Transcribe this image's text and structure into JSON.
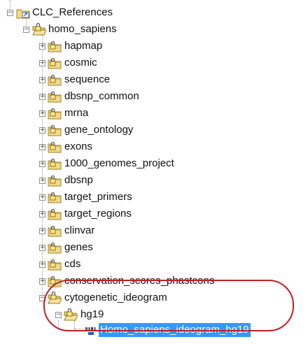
{
  "tree": {
    "root": {
      "label": "CLC_References",
      "icon": "database-folder-icon",
      "expanded": true
    },
    "homo_sapiens": {
      "label": "homo_sapiens",
      "icon": "locked-folder-open-icon",
      "expanded": true
    },
    "children": [
      {
        "label": "hapmap",
        "icon": "locked-folder-icon",
        "expanded": false
      },
      {
        "label": "cosmic",
        "icon": "locked-folder-icon",
        "expanded": false
      },
      {
        "label": "sequence",
        "icon": "locked-folder-icon",
        "expanded": false
      },
      {
        "label": "dbsnp_common",
        "icon": "locked-folder-icon",
        "expanded": false
      },
      {
        "label": "mrna",
        "icon": "locked-folder-icon",
        "expanded": false
      },
      {
        "label": "gene_ontology",
        "icon": "locked-folder-icon",
        "expanded": false
      },
      {
        "label": "exons",
        "icon": "locked-folder-icon",
        "expanded": false
      },
      {
        "label": "1000_genomes_project",
        "icon": "locked-folder-icon",
        "expanded": false
      },
      {
        "label": "dbsnp",
        "icon": "locked-folder-icon",
        "expanded": false
      },
      {
        "label": "target_primers",
        "icon": "locked-folder-icon",
        "expanded": false
      },
      {
        "label": "target_regions",
        "icon": "locked-folder-icon",
        "expanded": false
      },
      {
        "label": "clinvar",
        "icon": "locked-folder-icon",
        "expanded": false
      },
      {
        "label": "genes",
        "icon": "locked-folder-icon",
        "expanded": false
      },
      {
        "label": "cds",
        "icon": "locked-folder-icon",
        "expanded": false
      },
      {
        "label": "conservation_scores_phastcons",
        "icon": "locked-folder-icon",
        "expanded": false
      },
      {
        "label": "cytogenetic_ideogram",
        "icon": "locked-folder-open-icon",
        "expanded": true
      }
    ],
    "hg19": {
      "label": "hg19",
      "icon": "locked-folder-open-icon",
      "expanded": true
    },
    "leaf": {
      "label": "Homo_sapiens_ideogram_hg19",
      "icon": "ideogram-track-icon",
      "selected": true
    }
  },
  "colors": {
    "selection": "#3399ff",
    "highlight_ring": "#c0202a",
    "folder": "#f3d98a"
  }
}
